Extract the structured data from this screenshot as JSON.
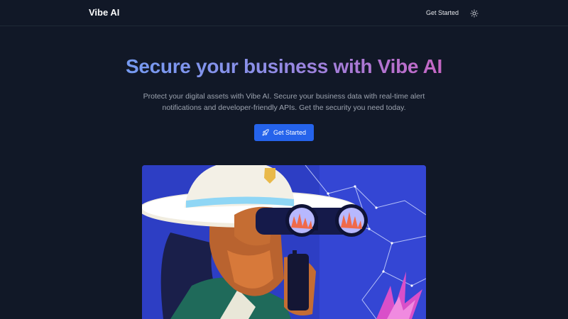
{
  "header": {
    "brand": "Vibe AI",
    "nav_get_started": "Get Started",
    "theme_toggle_icon": "sun-icon"
  },
  "hero": {
    "title": "Secure your business with Vibe AI",
    "description": "Protect your digital assets with Vibe AI. Secure your business data with real-time alert notifications and developer-friendly APIs. Get the security you need today.",
    "cta_label": "Get Started",
    "cta_icon": "rocket-icon",
    "image_subject": "illustration-person-binoculars"
  },
  "colors": {
    "background": "#111827",
    "accent": "#2563eb",
    "gradient_start": "#60a5fa",
    "gradient_end": "#ec4899"
  }
}
